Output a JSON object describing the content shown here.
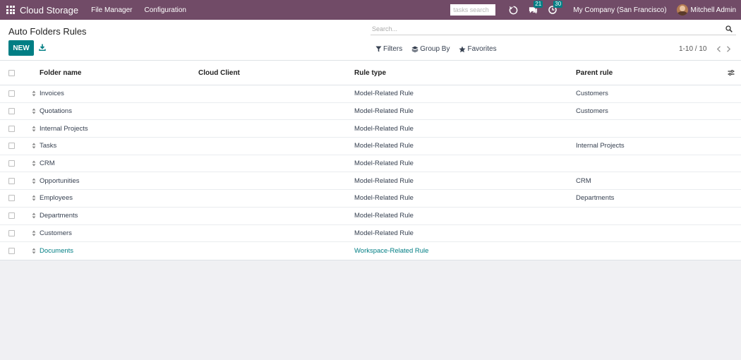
{
  "navbar": {
    "brand": "Cloud Storage",
    "menus": [
      "File Manager",
      "Configuration"
    ],
    "task_search_placeholder": "tasks search",
    "messages_count": "21",
    "activities_count": "30",
    "company": "My Company (San Francisco)",
    "user": "Mitchell Admin"
  },
  "control": {
    "title": "Auto Folders Rules",
    "new_label": "NEW",
    "search_placeholder": "Search...",
    "filters_label": "Filters",
    "group_by_label": "Group By",
    "favorites_label": "Favorites",
    "pager": "1-10 / 10"
  },
  "table": {
    "columns": [
      "Folder name",
      "Cloud Client",
      "Rule type",
      "Parent rule"
    ],
    "rows": [
      {
        "folder": "Invoices",
        "client": "",
        "type": "Model-Related Rule",
        "parent": "Customers"
      },
      {
        "folder": "Quotations",
        "client": "",
        "type": "Model-Related Rule",
        "parent": "Customers"
      },
      {
        "folder": "Internal Projects",
        "client": "",
        "type": "Model-Related Rule",
        "parent": ""
      },
      {
        "folder": "Tasks",
        "client": "",
        "type": "Model-Related Rule",
        "parent": "Internal Projects"
      },
      {
        "folder": "CRM",
        "client": "",
        "type": "Model-Related Rule",
        "parent": ""
      },
      {
        "folder": "Opportunities",
        "client": "",
        "type": "Model-Related Rule",
        "parent": "CRM"
      },
      {
        "folder": "Employees",
        "client": "",
        "type": "Model-Related Rule",
        "parent": "Departments"
      },
      {
        "folder": "Departments",
        "client": "",
        "type": "Model-Related Rule",
        "parent": ""
      },
      {
        "folder": "Customers",
        "client": "",
        "type": "Model-Related Rule",
        "parent": ""
      },
      {
        "folder": "Documents",
        "client": "",
        "type": "Workspace-Related Rule",
        "parent": ""
      }
    ]
  },
  "colors": {
    "navbar": "#714b67",
    "primary": "#017e84",
    "link": "#017e84"
  },
  "icons": [
    "apps-grid-icon",
    "chat-icon",
    "messages-icon",
    "activity-icon",
    "download-icon",
    "search-icon",
    "filter-icon",
    "layers-icon",
    "star-icon",
    "chevron-left-icon",
    "chevron-right-icon",
    "drag-handle-icon",
    "column-settings-icon"
  ]
}
